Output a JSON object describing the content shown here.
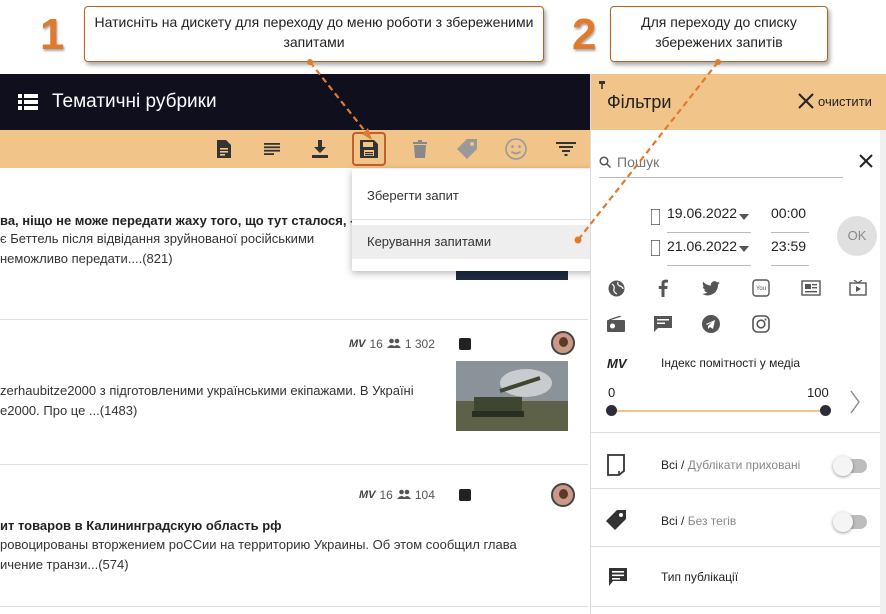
{
  "callouts": {
    "step1_num": "1",
    "step1_text": "Натисніть на дискету для переходу до меню роботи з збереженими запитами",
    "step2_num": "2",
    "step2_text": "Для переходу до списку збережених запитів"
  },
  "app": {
    "title": "Тематичні рубрики"
  },
  "dropdown": {
    "save_query": "Зберегти запит",
    "manage_queries": "Керування запитами"
  },
  "news": [
    {
      "title": "ва, ніщо не може передати жаху того, що тут сталося, -",
      "line1": "є Беттель після відвідання зруйнованої російськими",
      "line2": "неможливо передати....(821)"
    },
    {
      "mv_label": "MV",
      "mv_value": "16",
      "audience": "1 302",
      "line1": "zerhaubitze2000 з підготовленими українськими екіпажами. В Україні",
      "line2": "e2000. Про це ...(1483)"
    },
    {
      "mv_label": "MV",
      "mv_value": "16",
      "audience": "104",
      "title": "ит товаров в Калининградскую область рф",
      "line1": "ровоцированы вторжением роССии на территорию Украины. Об этом сообщил глава",
      "line2": "ичение транзи...(574)"
    }
  ],
  "filters": {
    "title": "Фільтри",
    "clear_label": "очистити",
    "search_placeholder": "Пошук",
    "date_from": "19.06.2022",
    "time_from": "00:00",
    "date_to": "21.06.2022",
    "time_to": "23:59",
    "ok_label": "OK",
    "media_index_label": "Індекс помітності у медіа",
    "mv_label": "MV",
    "range_min": "0",
    "range_max": "100",
    "duplicates_all": "Всі",
    "duplicates_hint": "Дублікати приховані",
    "tags_all": "Всі",
    "tags_hint": "Без тегів",
    "pub_type_label": "Тип публікації"
  },
  "colors": {
    "accent": "#f1c48a",
    "header_dark": "#0f0f1e",
    "callout_orange": "#e07b2d"
  }
}
